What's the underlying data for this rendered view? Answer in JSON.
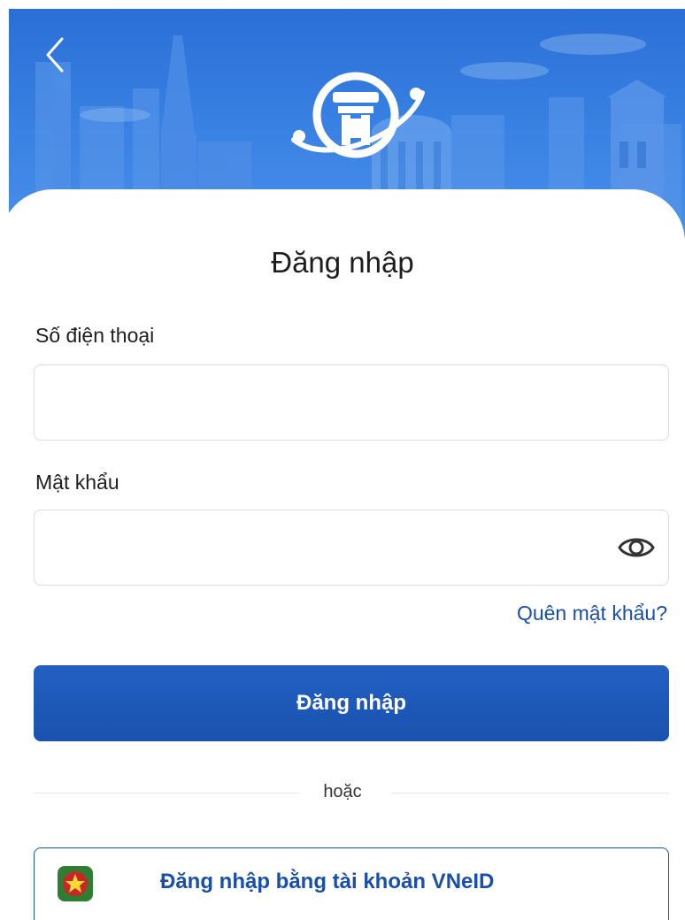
{
  "header": {
    "back_icon": "chevron-left-icon",
    "logo_icon": "hanoi-emblem-icon"
  },
  "login_form": {
    "title": "Đăng nhập",
    "phone_label": "Số điện thoại",
    "phone_value": "",
    "password_label": "Mật khẩu",
    "password_value": "",
    "password_toggle_icon": "eye-icon",
    "forgot_password": "Quên mật khẩu?",
    "submit_label": "Đăng nhập"
  },
  "alternate": {
    "divider_text": "hoặc",
    "vneid_label": "Đăng nhập bằng tài khoản VNeID",
    "vneid_icon": "vneid-emblem-icon"
  },
  "colors": {
    "banner": "#3a82e4",
    "primary": "#1a52ae",
    "link": "#1a4fa8"
  }
}
